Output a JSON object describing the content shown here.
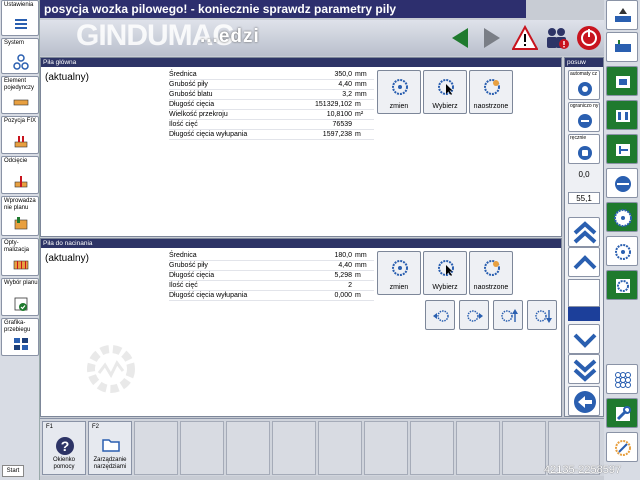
{
  "header": {
    "alarm": "posycja wozka pilowego! - koniecznie sprawdz parametry pily",
    "title": "...edzi",
    "watermark": "GINDUMAC"
  },
  "sidebar_left": {
    "items": [
      {
        "label": "Ustawienia"
      },
      {
        "label": "System"
      },
      {
        "label": "Element pojedynczy"
      },
      {
        "label": "Pozycja FIX"
      },
      {
        "label": "Odcięcie"
      },
      {
        "label": "Wprowadza nie planu"
      },
      {
        "label": "Opty- malizacja"
      },
      {
        "label": "Wybór planu"
      },
      {
        "label": "Grafika- przebiegu"
      }
    ],
    "start_label": "Start"
  },
  "panel_main": {
    "title": "Piła główna",
    "current": "(aktualny)",
    "rows": [
      {
        "label": "Średnica",
        "value": "350,0",
        "unit": "mm"
      },
      {
        "label": "Grubość piły",
        "value": "4,40",
        "unit": "mm"
      },
      {
        "label": "Grubość blatu",
        "value": "3,2",
        "unit": "mm"
      },
      {
        "label": "Długość cięcia",
        "value": "151329,102",
        "unit": "m"
      },
      {
        "label": "Wielkość przekroju",
        "value": "10,8100",
        "unit": "m²"
      },
      {
        "label": "Ilość cięć",
        "value": "76539",
        "unit": ""
      },
      {
        "label": "Długość cięcia wyłupania",
        "value": "1597,238",
        "unit": "m"
      }
    ],
    "buttons": {
      "change": "zmien",
      "select": "Wybierz",
      "sharpened": "naostrzone"
    }
  },
  "panel_score": {
    "title": "Piła do nacinania",
    "current": "(aktualny)",
    "rows": [
      {
        "label": "Średnica",
        "value": "180,0",
        "unit": "mm"
      },
      {
        "label": "Grubość piły",
        "value": "4,40",
        "unit": "mm"
      },
      {
        "label": "Długość cięcia",
        "value": "5,298",
        "unit": "m"
      },
      {
        "label": "Ilość cięć",
        "value": "2",
        "unit": ""
      },
      {
        "label": "Długość cięcia wyłupania",
        "value": "0,000",
        "unit": "m"
      }
    ],
    "buttons": {
      "change": "zmien",
      "select": "Wybierz",
      "sharpened": "naostrzone"
    }
  },
  "posuw": {
    "title": "posuw",
    "mode_auto": "automaty cz",
    "mode_limited": "ograniczo ny",
    "mode_manual": "ręcznie",
    "value1": "0,0",
    "value2": "55,1"
  },
  "fkeys": [
    {
      "key": "F1",
      "label": "Okienko pomocy"
    },
    {
      "key": "F2",
      "label": "Zarządzanie narzędziami"
    }
  ],
  "footer": {
    "serial": "42135-2258597"
  },
  "colors": {
    "header": "#2d2f6e",
    "panel_head": "#2d3466",
    "accent_blue": "#2a5fb0",
    "green": "#1f7a2e",
    "red": "#c8141e"
  }
}
